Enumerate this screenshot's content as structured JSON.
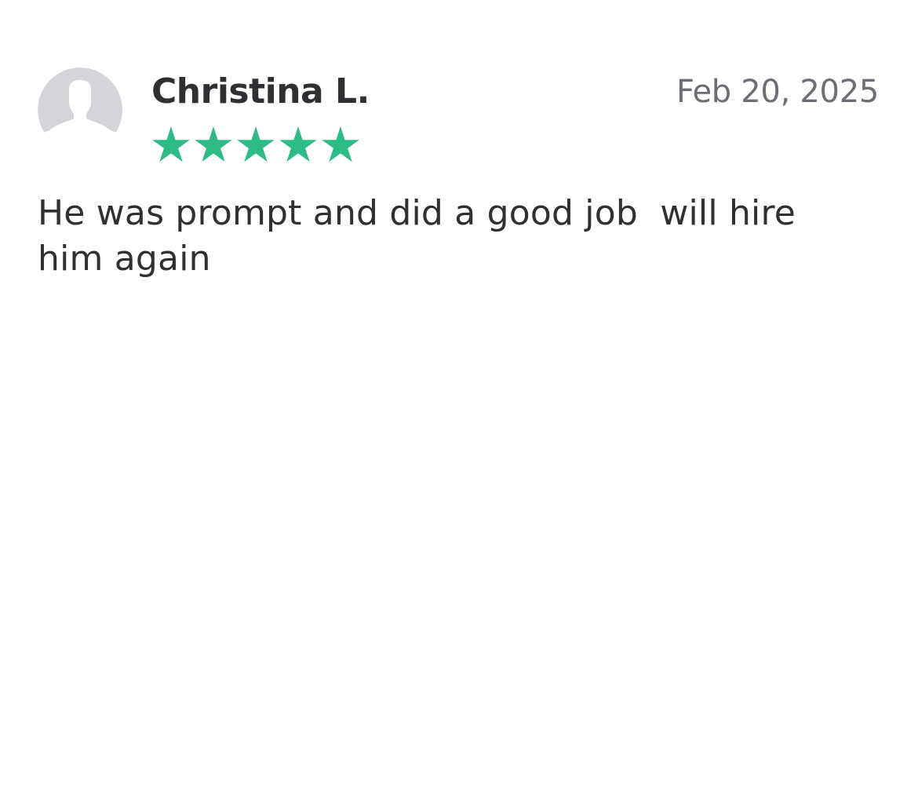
{
  "review": {
    "reviewer_name": "Christina L.",
    "date": "Feb 20, 2025",
    "rating": {
      "value": 5,
      "max": 5,
      "icon": "star-icon",
      "color": "#2dbb87"
    },
    "text": "He was prompt and did a good job  will hire him again",
    "avatar_icon": "default-user-avatar-icon"
  },
  "colors": {
    "avatar_background": "#d4d5d8",
    "avatar_silhouette": "#ffffff",
    "name_text": "#2f3033",
    "date_text": "#6b6e75",
    "body_text": "#2f3033"
  }
}
